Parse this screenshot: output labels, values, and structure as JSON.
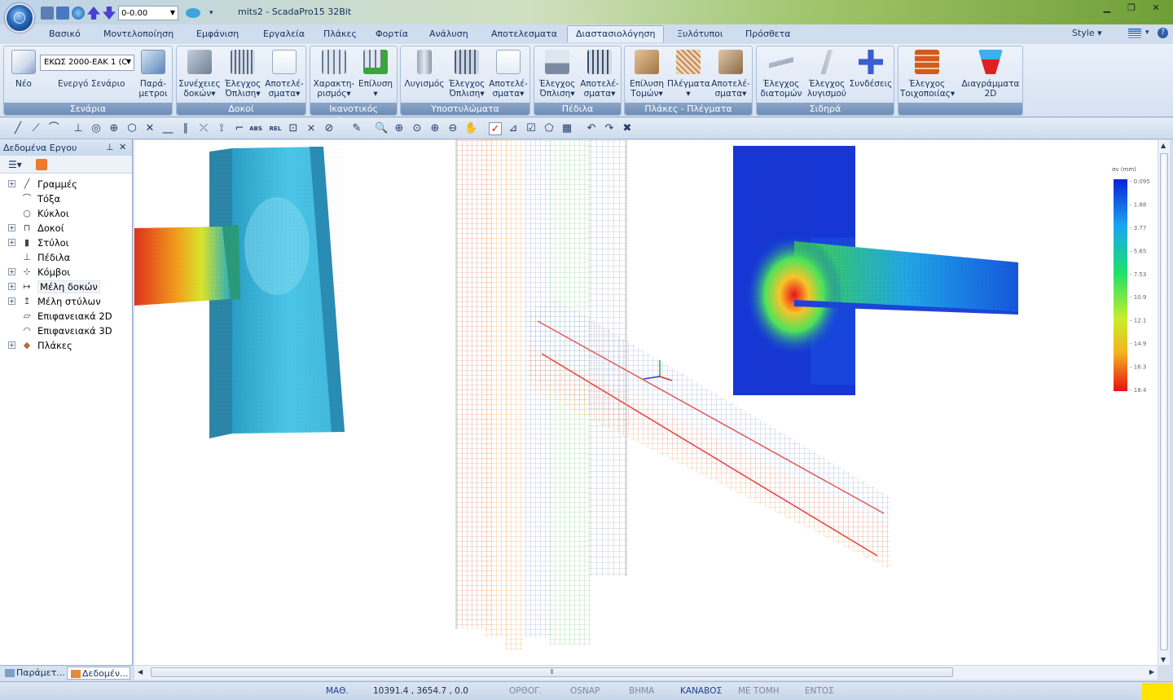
{
  "title_bar": {
    "app_title": "mits2 - ScadaPro15 32Bit",
    "layer_value": "0-0.00",
    "window_buttons": [
      "minimize-icon",
      "restore-icon",
      "close-icon"
    ]
  },
  "menu": {
    "tabs": [
      "Βασικό",
      "Μοντελοποίηση",
      "Εμφάνιση",
      "Εργαλεία",
      "Πλάκες",
      "Φορτία",
      "Ανάλυση",
      "Αποτελεσματα",
      "Διαστασιολόγηση",
      "Ξυλότυποι",
      "Πρόσθετα"
    ],
    "active_tab": "Διαστασιολόγηση",
    "style_label": "Style"
  },
  "ribbon": {
    "groups": [
      {
        "title": "Σενάρια"
      },
      {
        "title": "Δοκοί"
      },
      {
        "title": "Ικανοτικός έλεγχος"
      },
      {
        "title": "Υποστυλώματα"
      },
      {
        "title": "Πέδιλα"
      },
      {
        "title": "Πλάκες - Πλέγματα"
      },
      {
        "title": "Σιδηρά"
      },
      {
        "title": ""
      }
    ],
    "scenario": {
      "new_label": "Νέο",
      "select_value": "ΕΚΩΣ 2000-ΕΑΚ 1 (C",
      "active_label": "Ενεργό Σενάριο",
      "params_label_1": "Παρά-",
      "params_label_2": "μετροι"
    },
    "beams": {
      "b1_1": "Συνέχειες",
      "b1_2": "δοκών",
      "b2_1": "Έλεγχος",
      "b2_2": "Όπλιση",
      "b3_1": "Αποτελέ-",
      "b3_2": "σματα"
    },
    "capacity": {
      "b1_1": "Χαρακτη-",
      "b1_2": "ρισμός",
      "b2_1": "Επίλυση",
      "b2_2": ""
    },
    "columns": {
      "b1_1": "Λυγισμός",
      "b1_2": "",
      "b2_1": "Έλεγχος",
      "b2_2": "Όπλιση",
      "b3_1": "Αποτελέ-",
      "b3_2": "σματα"
    },
    "footings": {
      "b1_1": "Έλεγχος",
      "b1_2": "Όπλιση",
      "b2_1": "Αποτελέ-",
      "b2_2": "σματα"
    },
    "slabs": {
      "b1_1": "Επίλυση",
      "b1_2": "Τομών",
      "b2_1": "Πλέγματα",
      "b2_2": "",
      "b3_1": "Αποτελέ-",
      "b3_2": "σματα"
    },
    "steel": {
      "b1_1": "Έλεγχος",
      "b1_2": "διατομών",
      "b2_1": "Έλεγχος",
      "b2_2": "λυγισμού",
      "b3_1": "Συνδέσεις",
      "b3_2": ""
    },
    "masonry": {
      "b1_1": "Έλεγχος",
      "b1_2": "Τοιχοποιίας",
      "b2_1": "Διαγράμματα",
      "b2_2": "2D"
    }
  },
  "sidebar": {
    "title": "Δεδομένα Εργου",
    "pin_icon": "pin-icon",
    "close_icon": "close-icon",
    "items": [
      {
        "label": "Γραμμές",
        "expandable": true,
        "icon": "line-icon"
      },
      {
        "label": "Τόξα",
        "expandable": false,
        "icon": "arc-icon"
      },
      {
        "label": "Κύκλοι",
        "expandable": false,
        "icon": "circle-icon"
      },
      {
        "label": "Δοκοί",
        "expandable": true,
        "icon": "beam-icon"
      },
      {
        "label": "Στύλοι",
        "expandable": true,
        "icon": "column-icon"
      },
      {
        "label": "Πέδιλα",
        "expandable": false,
        "icon": "footing-icon"
      },
      {
        "label": "Κόμβοι",
        "expandable": true,
        "icon": "node-icon"
      },
      {
        "label": "Μέλη δοκών",
        "expandable": true,
        "icon": "beam-member-icon"
      },
      {
        "label": "Μέλη στύλων",
        "expandable": true,
        "icon": "column-member-icon"
      },
      {
        "label": "Επιφανειακά 2D",
        "expandable": false,
        "icon": "surface-2d-icon"
      },
      {
        "label": "Επιφανειακά 3D",
        "expandable": false,
        "icon": "surface-3d-icon"
      },
      {
        "label": "Πλάκες",
        "expandable": true,
        "icon": "slab-icon"
      }
    ],
    "bottom_tabs": [
      "Παράμετ...",
      "Δεδομέν..."
    ]
  },
  "legend": {
    "title": "σv (mm)",
    "values": [
      "0.095",
      "1.88",
      "3.77",
      "5.65",
      "7.53",
      "10.9",
      "12.1",
      "14.9",
      "16.3",
      "18.4"
    ]
  },
  "colors": {
    "accent": "#2f5fa7",
    "ribbon_group_title": "#7290b9",
    "status_active": "#1c3d8e",
    "highlight_yellow": "#ffe400"
  },
  "status": {
    "math": "ΜΑΘ.",
    "coords": "10391.4 , 3654.7 , 0.0",
    "ortho": "ΟΡΘΟΓ.",
    "osnap": "OSNAP",
    "step": "ΒΗΜΑ",
    "grid": "ΚΑΝΑΒΟΣ",
    "intersect": "ΜΕ ΤΟΜΗ",
    "inside": "ΕΝΤΟΣ"
  }
}
